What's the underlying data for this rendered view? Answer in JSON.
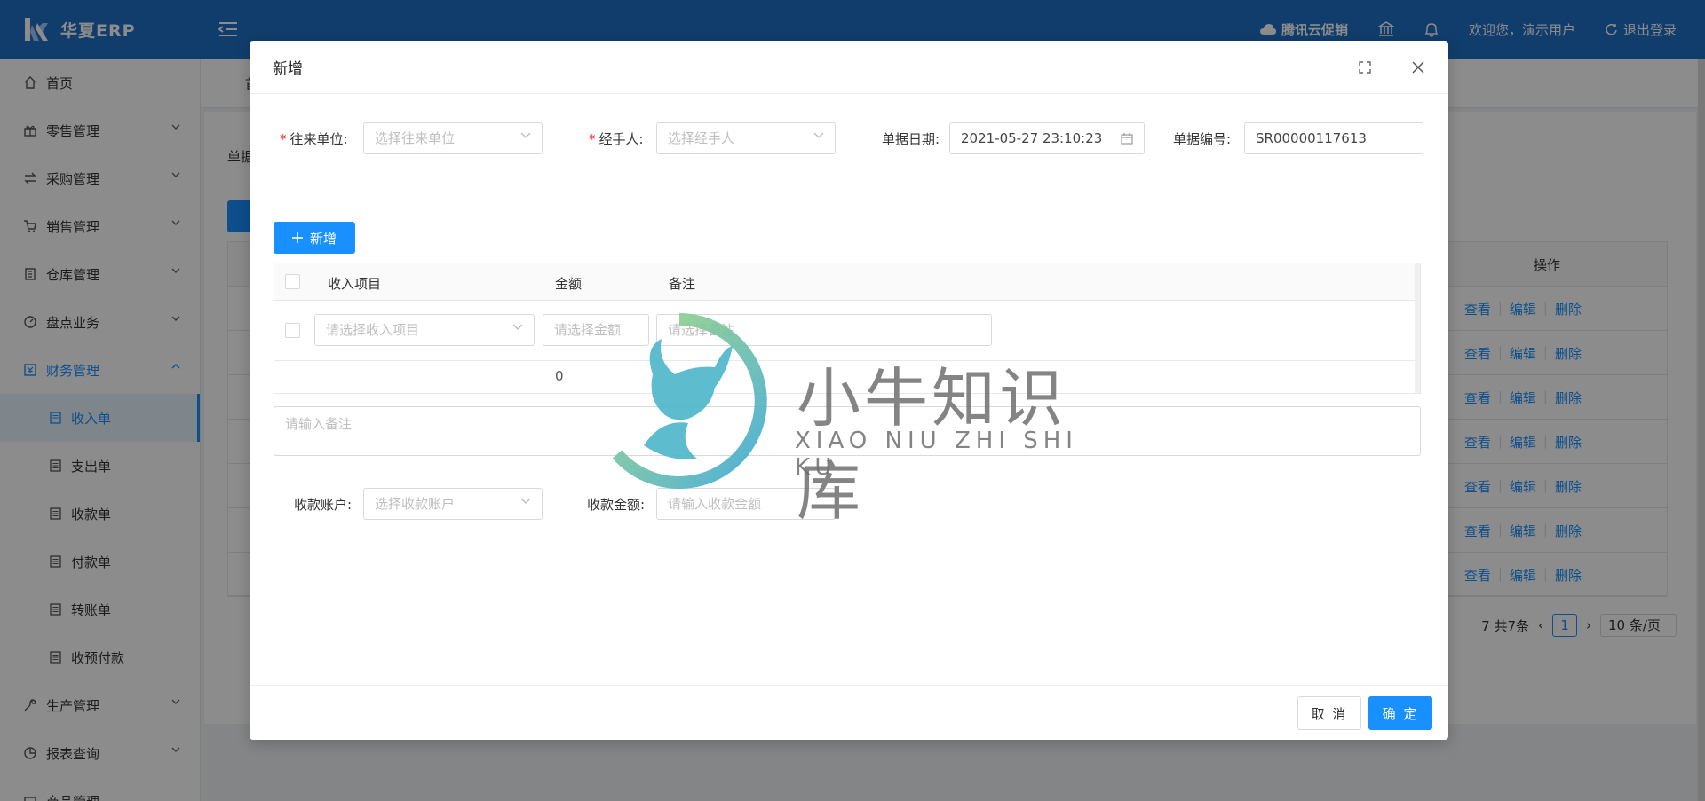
{
  "app": {
    "name": "华夏ERP"
  },
  "header": {
    "promo": "腾讯云促销",
    "welcome": "欢迎您，演示用户",
    "logout": "退出登录"
  },
  "sidebar": {
    "items": [
      {
        "label": "首页"
      },
      {
        "label": "零售管理"
      },
      {
        "label": "采购管理"
      },
      {
        "label": "销售管理"
      },
      {
        "label": "仓库管理"
      },
      {
        "label": "盘点业务"
      },
      {
        "label": "财务管理"
      }
    ],
    "sub": [
      {
        "label": "收入单"
      },
      {
        "label": "支出单"
      },
      {
        "label": "收款单"
      },
      {
        "label": "付款单"
      },
      {
        "label": "转账单"
      },
      {
        "label": "收预付款"
      }
    ],
    "more": [
      {
        "label": "生产管理"
      },
      {
        "label": "报表查询"
      },
      {
        "label": "商品管理"
      }
    ]
  },
  "background": {
    "tab_first": "首",
    "label_prefix": "单据",
    "op_header": "操作",
    "actions": {
      "view": "查看",
      "edit": "编辑",
      "delete": "删除"
    },
    "pager": {
      "total": "7 共7条",
      "current": "1",
      "page_size": "10 条/页"
    }
  },
  "modal": {
    "title": "新增",
    "fields": {
      "partner_label": "往来单位:",
      "partner_placeholder": "选择往来单位",
      "handler_label": "经手人:",
      "handler_placeholder": "选择经手人",
      "date_label": "单据日期:",
      "date_value": "2021-05-27 23:10:23",
      "number_label": "单据编号:",
      "number_value": "SR00000117613"
    },
    "add_button": "新增",
    "grid": {
      "headers": {
        "item": "收入项目",
        "amount": "金额",
        "remark": "备注"
      },
      "row": {
        "item_placeholder": "请选择收入项目",
        "amount_placeholder": "请选择金额",
        "remark_placeholder": "请选择备注"
      },
      "total": "0"
    },
    "remark_placeholder": "请输入备注",
    "account_label": "收款账户:",
    "account_placeholder": "选择收款账户",
    "collect_label": "收款金额:",
    "collect_placeholder": "请输入收款金额",
    "cancel": "取 消",
    "ok": "确 定"
  },
  "watermark": {
    "cn": "小牛知识库",
    "en": "XIAO NIU ZHI SHI KU"
  },
  "colors": {
    "primary": "#1890ff",
    "header": "#1f6fc5",
    "required": "#f5222d"
  }
}
